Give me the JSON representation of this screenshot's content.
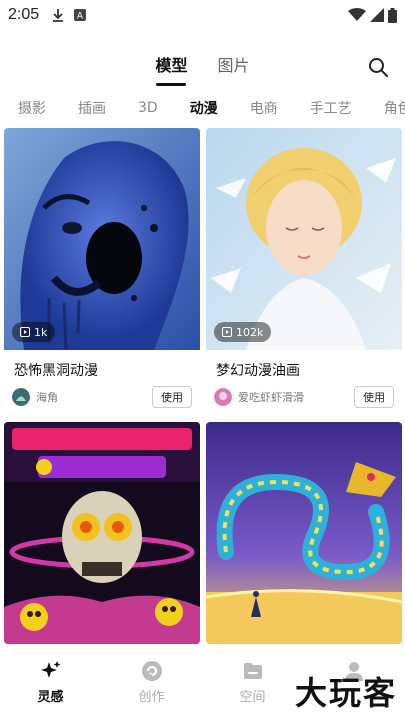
{
  "status_bar": {
    "time": "2:05",
    "icons": [
      "download-icon",
      "notification-icon",
      "wifi-icon",
      "signal-icon",
      "battery-icon"
    ]
  },
  "header": {
    "tabs": [
      {
        "label": "模型",
        "active": true
      },
      {
        "label": "图片",
        "active": false
      }
    ],
    "search_icon": "search-icon"
  },
  "categories": [
    {
      "label": "摄影",
      "active": false
    },
    {
      "label": "插画",
      "active": false
    },
    {
      "label": "3D",
      "active": false
    },
    {
      "label": "动漫",
      "active": true
    },
    {
      "label": "电商",
      "active": false
    },
    {
      "label": "手工艺",
      "active": false
    },
    {
      "label": "角色",
      "active": false
    }
  ],
  "cards": [
    {
      "title": "恐怖黑洞动漫",
      "views": "1k",
      "author": "海角",
      "use_label": "使用",
      "theme": "blue-horror"
    },
    {
      "title": "梦幻动漫油画",
      "views": "102k",
      "author": "爱吃虾虾滑滑",
      "use_label": "使用",
      "theme": "dreamy-portrait"
    },
    {
      "title": "",
      "views": "",
      "author": "",
      "use_label": "",
      "theme": "skull-pop"
    },
    {
      "title": "",
      "views": "",
      "author": "",
      "use_label": "",
      "theme": "dragon-neon"
    }
  ],
  "bottom_nav": [
    {
      "label": "灵感",
      "icon": "sparkle-icon",
      "active": true
    },
    {
      "label": "创作",
      "icon": "create-icon",
      "active": false
    },
    {
      "label": "空间",
      "icon": "folder-icon",
      "active": false
    },
    {
      "label": "",
      "icon": "profile-icon",
      "active": false
    }
  ],
  "watermark": "大玩客",
  "colors": {
    "accent": "#111111",
    "inactive": "#aaaaaa"
  }
}
